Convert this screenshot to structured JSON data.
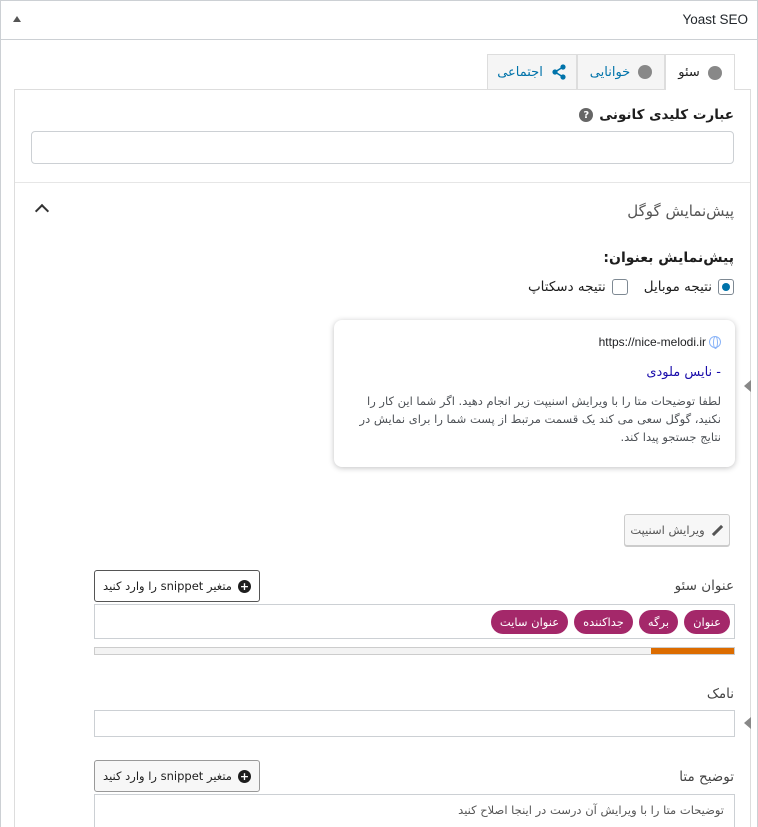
{
  "header": {
    "title": "Yoast SEO"
  },
  "tabs": [
    {
      "label": "سئو",
      "active": true
    },
    {
      "label": "خوانایی",
      "active": false
    },
    {
      "label": "اجتماعی",
      "active": false
    }
  ],
  "keyphrase": {
    "label": "عبارت کلیدی کانونی",
    "help": "?",
    "value": ""
  },
  "google_preview": {
    "title": "پیش‌نمایش گوگل",
    "preview_as_label": "پیش‌نمایش بعنوان:",
    "mobile_label": "نتیجه موبایل",
    "desktop_label": "نتیجه دسکتاپ",
    "mode": "mobile"
  },
  "snippet": {
    "url": "https://nice-melodi.ir",
    "title": "- نایس ملودی",
    "description": "لطفا توضیحات متا را با ویرایش اسنیپت زیر انجام دهید. اگر شما این کار را نکنید، گوگل سعی می کند یک قسمت مرتبط از پست شما را برای نمایش در نتایج جستجو پیدا کند."
  },
  "edit_snippet_label": "ویرایش اسنیپت",
  "seo_title": {
    "label": "عنوان سئو",
    "insert_label": "متغیر snippet را وارد کنید",
    "pills": [
      "عنوان",
      "برگه",
      "جداکننده",
      "عنوان سایت"
    ],
    "progress": 0.13,
    "progress_color": "#dc6c00"
  },
  "slug": {
    "label": "نامک",
    "value": ""
  },
  "meta_description": {
    "label": "توضیح متا",
    "insert_label": "متغیر snippet را وارد کنید",
    "placeholder": "توضیحات متا را با ویرایش آن درست در اینجا اصلاح کنید"
  },
  "colors": {
    "accent": "#0073aa",
    "pill": "#a4286a",
    "link": "#1a0dab"
  }
}
